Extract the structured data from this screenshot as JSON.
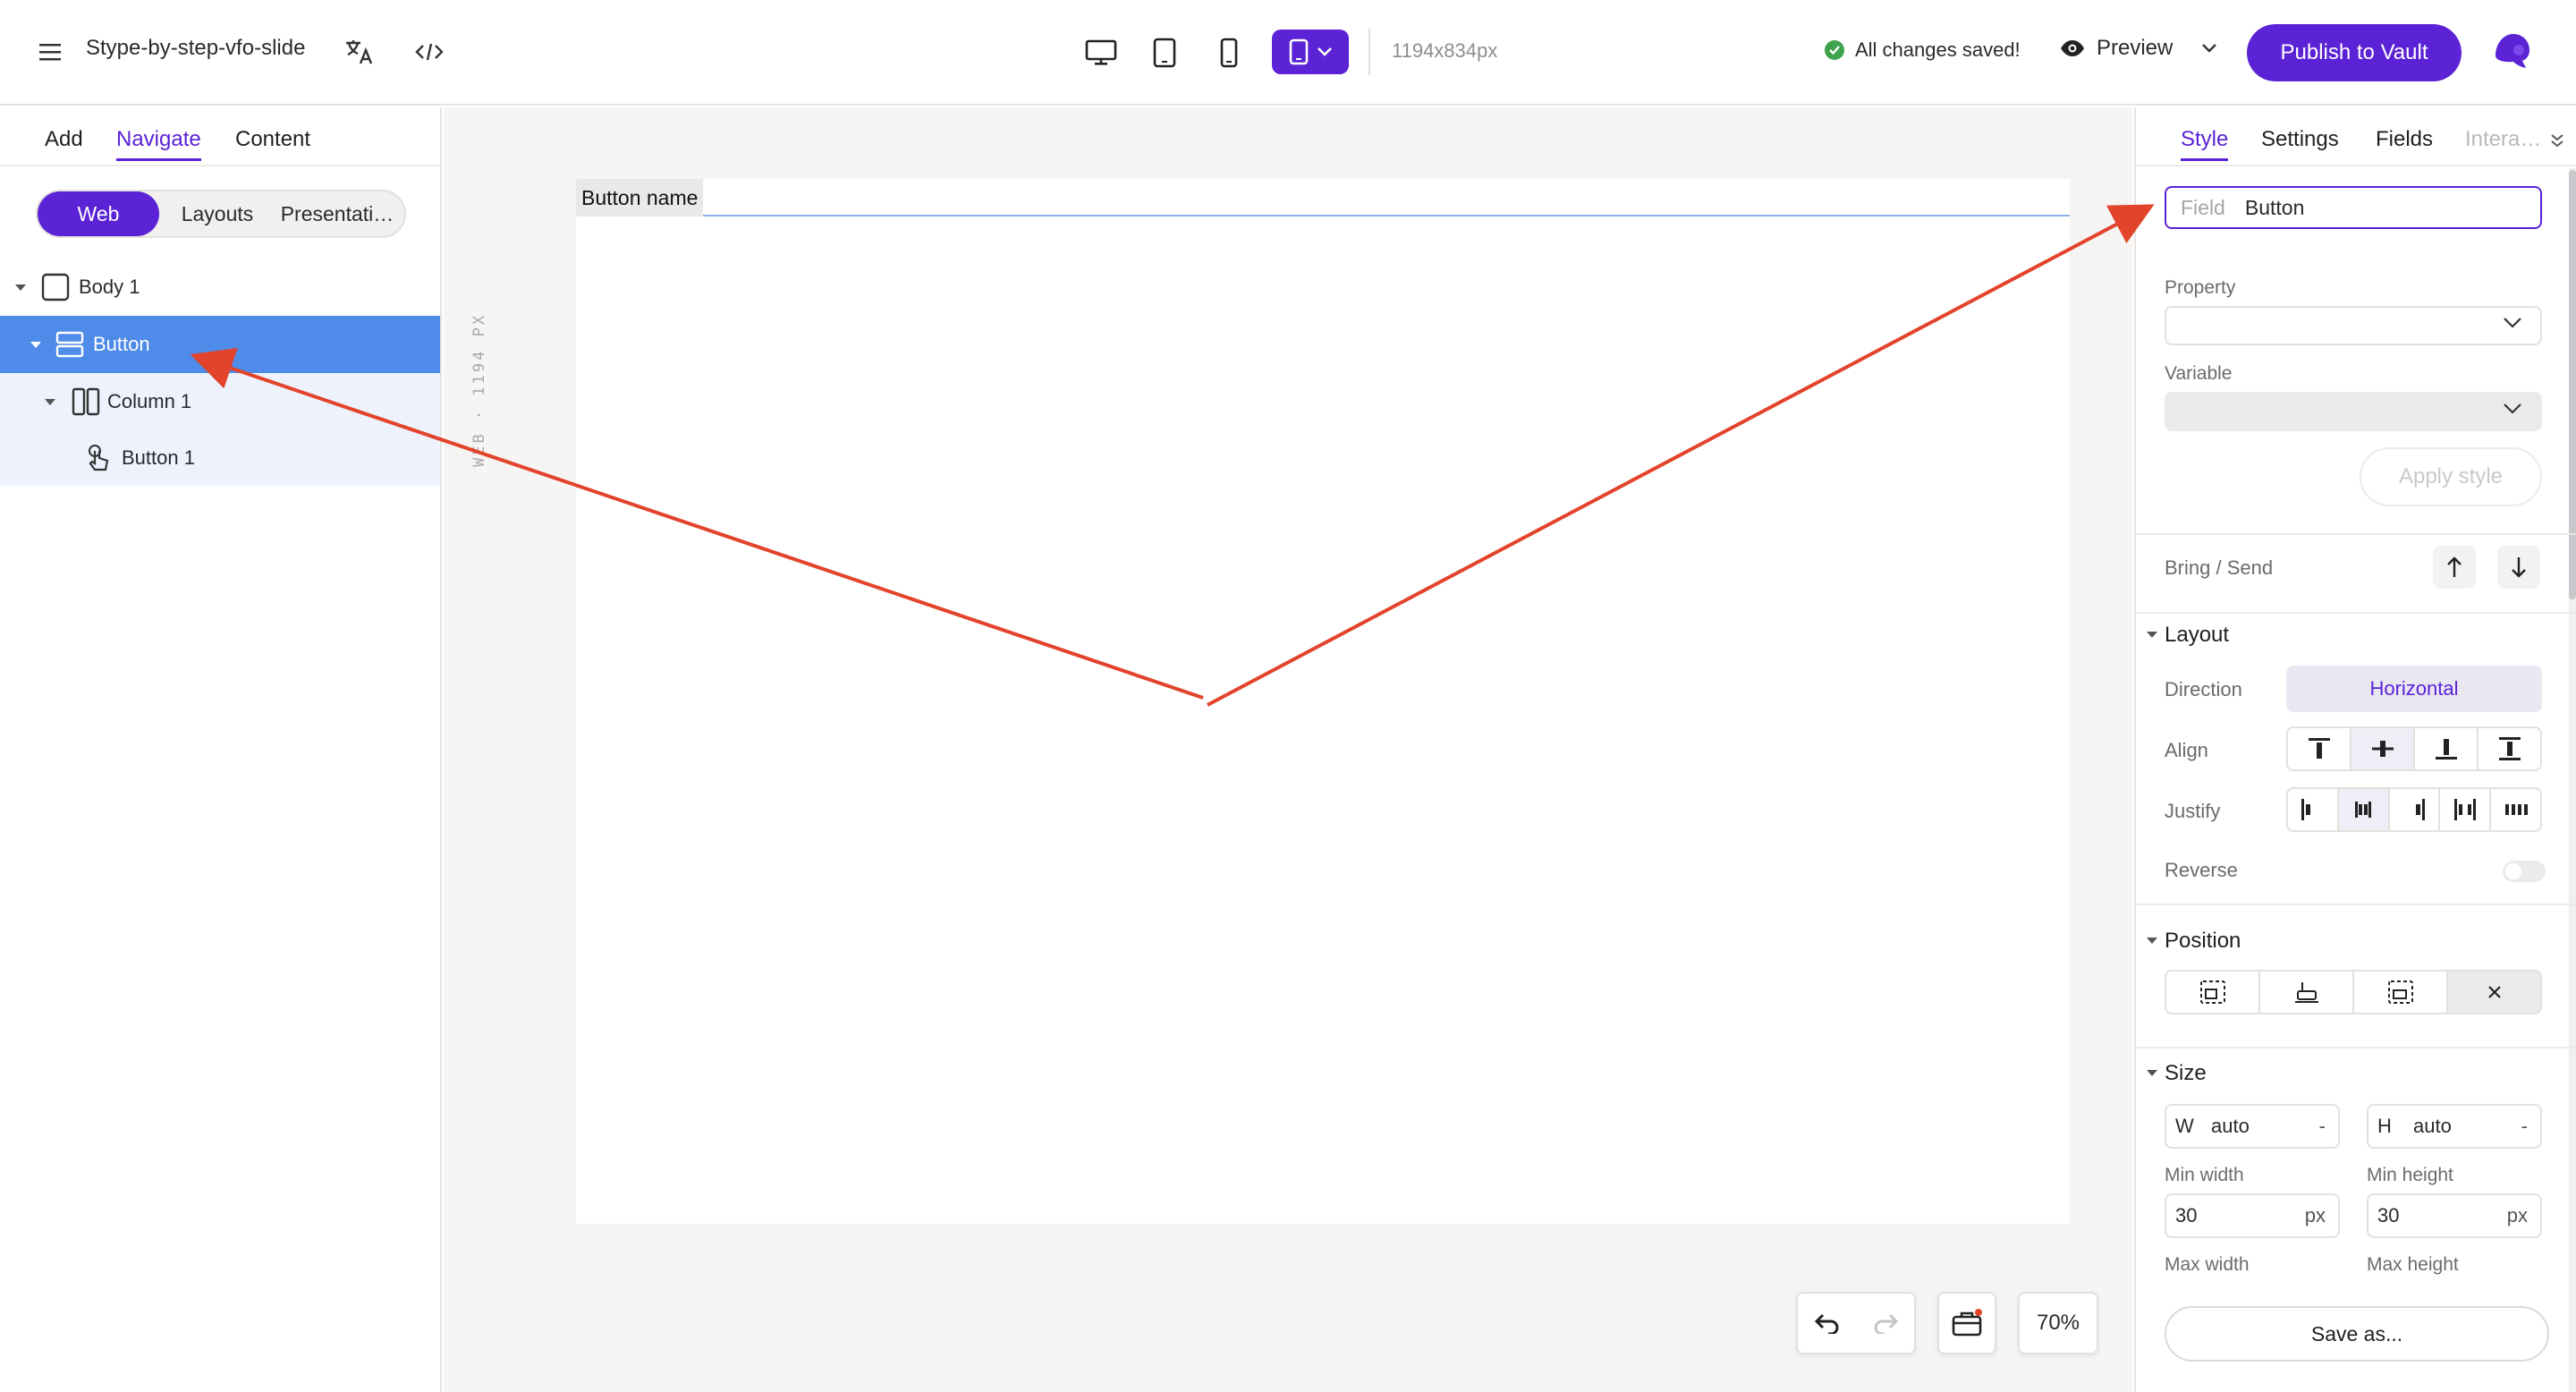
{
  "header": {
    "doc_title": "Stype-by-step-vfo-slide",
    "dimensions": "1194x834px",
    "saved_status": "All changes saved!",
    "preview_label": "Preview",
    "publish_label": "Publish to Vault"
  },
  "left_panel": {
    "tabs": [
      "Add",
      "Navigate",
      "Content"
    ],
    "active_tab": "Navigate",
    "segments": [
      "Web",
      "Layouts",
      "Presentati…"
    ],
    "tree": [
      {
        "label": "Body 1"
      },
      {
        "label": "Button"
      },
      {
        "label": "Column 1"
      },
      {
        "label": "Button 1"
      }
    ]
  },
  "canvas": {
    "ruler_label": "WEB · 1194 PX",
    "button_name": "Button name",
    "zoom": "70%"
  },
  "right_panel": {
    "tabs": [
      "Style",
      "Settings",
      "Fields",
      "Intera…"
    ],
    "active_tab": "Style",
    "field_label": "Field",
    "field_value": "Button",
    "property_label": "Property",
    "variable_label": "Variable",
    "apply_style": "Apply style",
    "bring_send": "Bring / Send",
    "layout_title": "Layout",
    "direction_label": "Direction",
    "direction_value": "Horizontal",
    "align_label": "Align",
    "justify_label": "Justify",
    "reverse_label": "Reverse",
    "position_title": "Position",
    "size_title": "Size",
    "width_prefix": "W",
    "width_value": "auto",
    "width_suffix": "-",
    "height_prefix": "H",
    "height_value": "auto",
    "height_suffix": "-",
    "min_width_label": "Min width",
    "min_width_value": "30",
    "min_width_unit": "px",
    "min_height_label": "Min height",
    "min_height_value": "30",
    "min_height_unit": "px",
    "max_width_label": "Max width",
    "max_height_label": "Max height",
    "save_as": "Save as..."
  },
  "colors": {
    "accent": "#5b22d6",
    "selection": "#4f8be8",
    "annotation": "#e2432b",
    "success": "#3fa34d"
  }
}
